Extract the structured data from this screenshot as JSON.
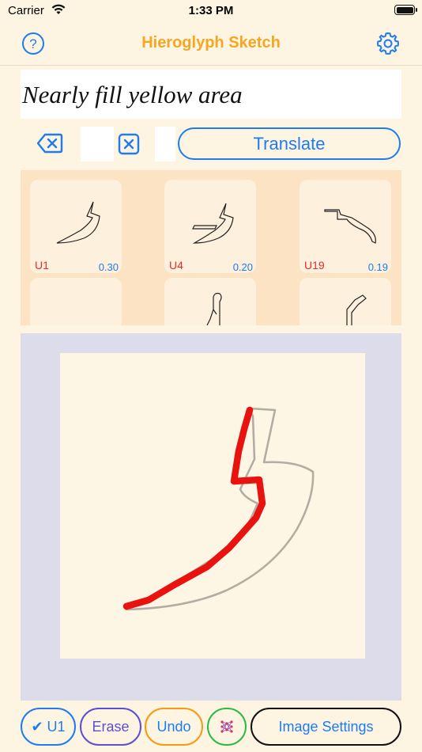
{
  "status_bar": {
    "carrier": "Carrier",
    "time": "1:33 PM"
  },
  "nav": {
    "title": "Hieroglyph Sketch",
    "help_icon": "help-icon",
    "settings_icon": "gear-icon"
  },
  "prompt": {
    "text": "Nearly fill yellow area"
  },
  "toolbar": {
    "backspace_icon": "backspace-icon",
    "clear_icon": "clear-icon",
    "translate_label": "Translate"
  },
  "results": [
    {
      "code": "U1",
      "score": "0.30"
    },
    {
      "code": "U4",
      "score": "0.20"
    },
    {
      "code": "U19",
      "score": "0.19"
    },
    {
      "code": "",
      "score": ""
    },
    {
      "code": "",
      "score": ""
    },
    {
      "code": "",
      "score": ""
    }
  ],
  "bottom_bar": {
    "selected_label": "✔ U1",
    "erase_label": "Erase",
    "undo_label": "Undo",
    "network_icon": "neural-network-icon",
    "image_settings_label": "Image Settings"
  },
  "colors": {
    "accent_orange": "#f5a623",
    "accent_blue": "#1e7cf2",
    "stroke_red": "#e8120f",
    "erase_purple": "#5b4fd6",
    "undo_orange": "#f59a12",
    "network_green": "#2fb84a"
  }
}
